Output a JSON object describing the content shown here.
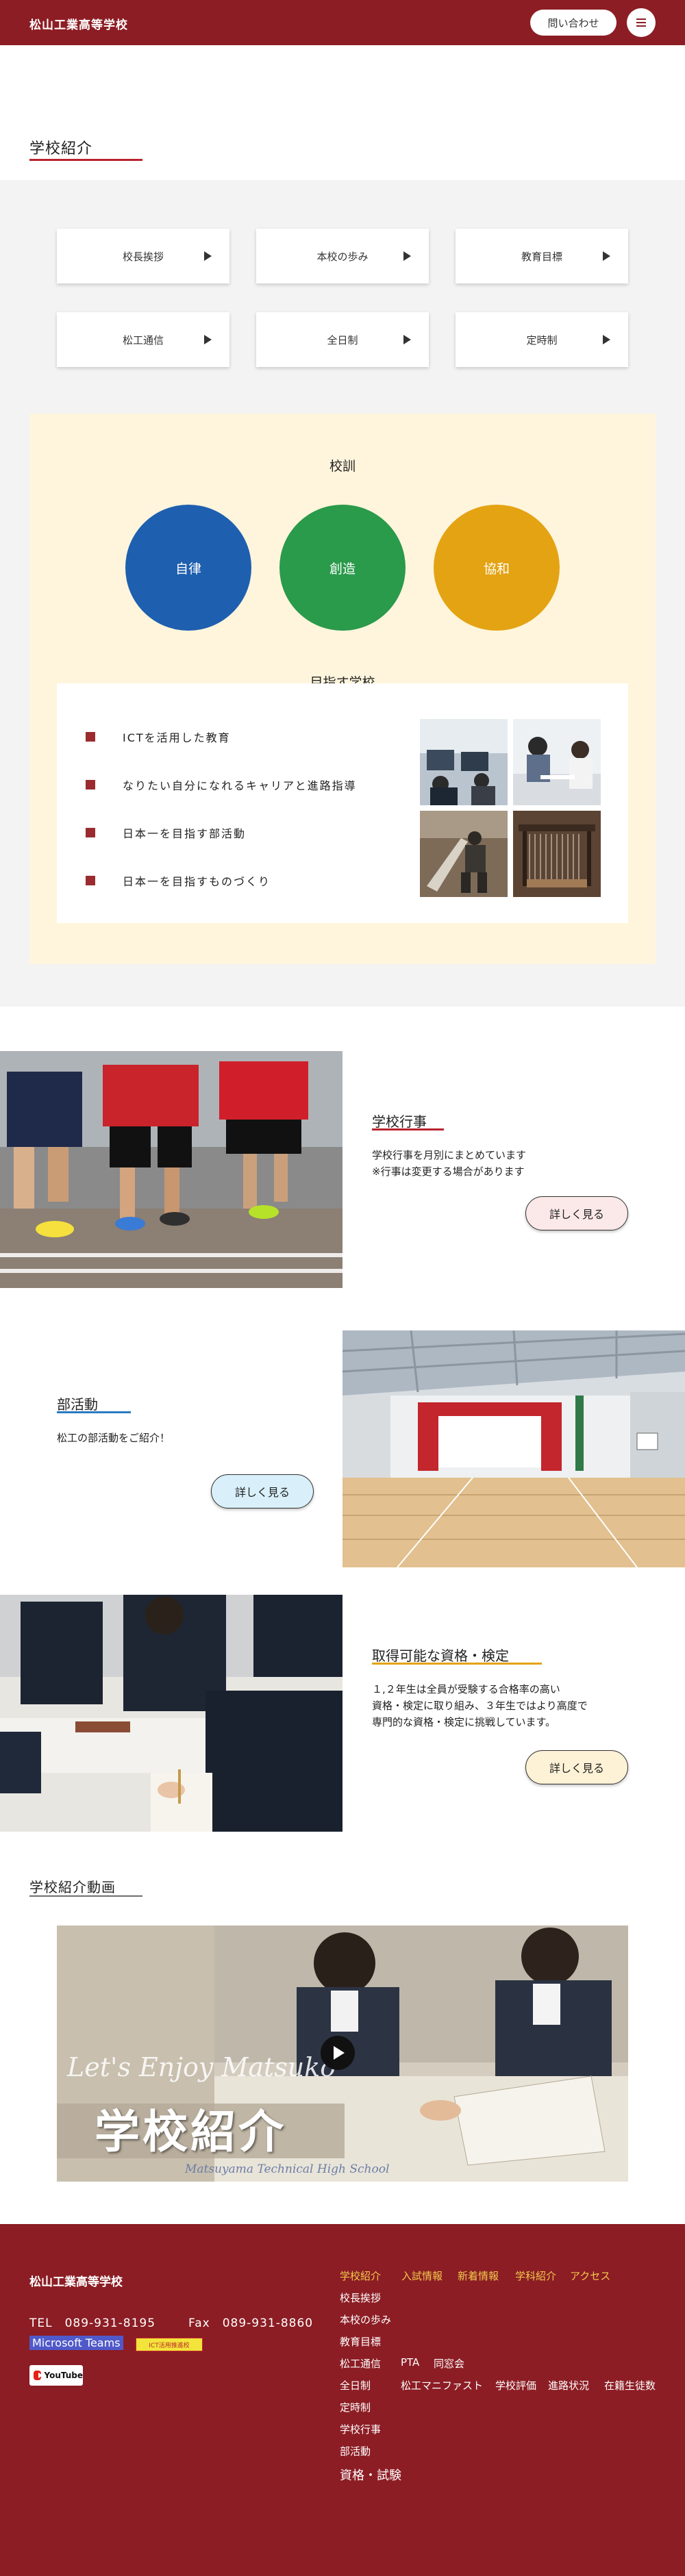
{
  "header": {
    "school_name": "松山工業高等学校",
    "contact_label": "問い合わせ",
    "menu_icon": "hamburger-menu-icon"
  },
  "intro": {
    "title": "学校紹介",
    "nav": [
      {
        "label": "校長挨拶"
      },
      {
        "label": "本校の歩み"
      },
      {
        "label": "教育目標"
      },
      {
        "label": "松工通信"
      },
      {
        "label": "全日制"
      },
      {
        "label": "定時制"
      }
    ]
  },
  "motto": {
    "heading": "校訓",
    "items": [
      {
        "label": "自律",
        "color": "#1e5faf"
      },
      {
        "label": "創造",
        "color": "#2a9a4b"
      },
      {
        "label": "協和",
        "color": "#e4a313"
      }
    ]
  },
  "goals": {
    "heading": "目指す学校",
    "items": [
      "ICTを活用した教育",
      "なりたい自分になれるキャリアと進路指導",
      "日本一を目指す部活動",
      "日本一を目指すものづくり"
    ]
  },
  "features": [
    {
      "title": "学校行事",
      "text": "学校行事を月別にまとめています\n※行事は変更する場合があります",
      "button": "詳しく見る",
      "accent": "#b8242d",
      "button_bg": "#fbe8e8"
    },
    {
      "title": "部活動",
      "text": "松工の部活動をご紹介！",
      "button": "詳しく見る",
      "accent": "#2b7bc0",
      "button_bg": "#d9f0fa"
    },
    {
      "title": "取得可能な資格・検定",
      "text": "１,２年生は全員が受験する合格率の高い\n資格・検定に取り組み、３年生ではより高度で\n専門的な資格・検定に挑戦しています。",
      "button": "詳しく見る",
      "accent": "#e4a313",
      "button_bg": "#fdf1d6"
    }
  ],
  "video": {
    "title": "学校紹介動画",
    "caption_en": "Let's Enjoy Matsuko",
    "caption_jp": "学校紹介",
    "caption_sub": "Matsuyama Technical High School"
  },
  "footer": {
    "school_name": "松山工業高等学校",
    "tel": "TEL　089-931-8195",
    "fax": "Fax　089-931-8860",
    "teams": "Microsoft Teams",
    "ict": "ICT活用推進校",
    "youtube": "YouTube",
    "nav_top": [
      "学校紹介",
      "入試情報",
      "新着情報",
      "学科紹介",
      "アクセス"
    ],
    "links": {
      "greeting": "校長挨拶",
      "history": "本校の歩み",
      "goals": "教育目標",
      "news": "松工通信",
      "pta": "PTA",
      "alumni": "同窓会",
      "fulltime": "全日制",
      "manifest": "松工マニファスト",
      "evaluation": "学校評価",
      "career": "進路状況",
      "enrollment": "在籍生徒数",
      "parttime": "定時制",
      "events": "学校行事",
      "clubs": "部活動",
      "qualifications": "資格・試験"
    }
  }
}
